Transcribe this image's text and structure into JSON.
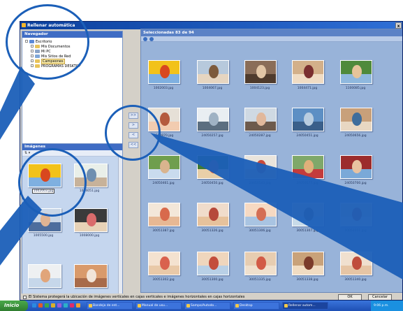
{
  "window": {
    "title": "Rellenar automática",
    "close_label": "x"
  },
  "navigator": {
    "header": "Navegador",
    "tree": [
      {
        "label": "Escritorio",
        "icon": "desktop-icon",
        "indent": 0,
        "color": "#5b8ad8"
      },
      {
        "label": "Mis Documentos",
        "icon": "folder-icon",
        "indent": 1,
        "color": "#e8c35a"
      },
      {
        "label": "Mi PC",
        "icon": "computer-icon",
        "indent": 1,
        "color": "#8aa4c8"
      },
      {
        "label": "Mis Sitios de Red",
        "icon": "network-icon",
        "indent": 1,
        "color": "#7fa7d8"
      },
      {
        "label": "Campeones",
        "icon": "folder-icon",
        "indent": 1,
        "color": "#e8c35a",
        "selected": true
      },
      {
        "label": "PROGRAMAS DESKTOP",
        "icon": "folder-icon",
        "indent": 1,
        "color": "#e8c35a"
      }
    ]
  },
  "images_panel": {
    "header": "Imágenes",
    "toolbar": "⇅ ▾",
    "thumbs": [
      {
        "caption": "1002003.jpg",
        "selected": true,
        "c1": "#f2c21a",
        "c2": "#d8471f",
        "c3": "#7fb0e0"
      },
      {
        "caption": "1004051.jpg",
        "selected": false,
        "c1": "#e9efe9",
        "c2": "#6f8fb0",
        "c3": "#c7b29a"
      },
      {
        "caption": "1005500.jpg",
        "selected": false,
        "c1": "#c9d6e6",
        "c2": "#e0b493",
        "c3": "#4d6d9d"
      },
      {
        "caption": "1008000.jpg",
        "selected": false,
        "c1": "#3a3a3a",
        "c2": "#d96b6b",
        "c3": "#e7d2b7"
      },
      {
        "caption": "",
        "selected": false,
        "c1": "#eef0f2",
        "c2": "#e1a57a",
        "c3": "#c6d7ea"
      },
      {
        "caption": "",
        "selected": false,
        "c1": "#d99a6b",
        "c2": "#f1e4d8",
        "c3": "#a86b4a"
      }
    ]
  },
  "move_buttons": [
    ">>",
    ">",
    "<",
    "<<"
  ],
  "selected_panel": {
    "header": "Seleccionadas 83 de 94",
    "thumbs": [
      {
        "caption": "1002003.jpg",
        "c1": "#f2c21a",
        "c2": "#d8471f",
        "c3": "#7fb0e0"
      },
      {
        "caption": "1004067.jpg",
        "c1": "#b7c9dc",
        "c2": "#7d5a3c",
        "c3": "#e6d5c0"
      },
      {
        "caption": "1004123.jpg",
        "c1": "#8a6d58",
        "c2": "#e2c6a6",
        "c3": "#4f3b2d"
      },
      {
        "caption": "1004471.jpg",
        "c1": "#d3b08a",
        "c2": "#7a2f2f",
        "c3": "#f0dcc4"
      },
      {
        "caption": "1100085.jpg",
        "c1": "#4f8a3b",
        "c2": "#e6c49a",
        "c3": "#8fb8de"
      },
      {
        "caption": "1508870.jpg",
        "c1": "#e6e0d7",
        "c2": "#b45a3e",
        "c3": "#f2ccb0"
      },
      {
        "caption": "24050257.jpg",
        "c1": "#e9eef2",
        "c2": "#9fb2c4",
        "c3": "#5b6e80"
      },
      {
        "caption": "24050287.jpg",
        "c1": "#cfd9e3",
        "c2": "#e1b89c",
        "c3": "#6d5a4d"
      },
      {
        "caption": "24050451.jpg",
        "c1": "#5d8fc4",
        "c2": "#b9cde0",
        "c3": "#3a5f8a"
      },
      {
        "caption": "24050656.jpg",
        "c1": "#c8a07a",
        "c2": "#3e6d9c",
        "c3": "#e8d7c2"
      },
      {
        "caption": "24050461.jpg",
        "c1": "#6f9e4e",
        "c2": "#d9b48e",
        "c3": "#c9dbee"
      },
      {
        "caption": "24050450.jpg",
        "c1": "#3f7a35",
        "c2": "#d75a3a",
        "c3": "#e8cfa8"
      },
      {
        "caption": "24050543.jpg",
        "c1": "#e9e4dc",
        "c2": "#c84a3b",
        "c3": "#e3c3a1"
      },
      {
        "caption": "24050577.jpg",
        "c1": "#7fa86a",
        "c2": "#e0b07a",
        "c3": "#c43c3c"
      },
      {
        "caption": "24050700.jpg",
        "c1": "#9c2c2c",
        "c2": "#e8c2a0",
        "c3": "#7aa9d8"
      },
      {
        "caption": "30051387.jpg",
        "c1": "#f3e7d9",
        "c2": "#d86a4c",
        "c3": "#e7b894"
      },
      {
        "caption": "30051326.jpg",
        "c1": "#f0dccb",
        "c2": "#b6493b",
        "c3": "#e6c29c"
      },
      {
        "caption": "30051306.jpg",
        "c1": "#f6d9c2",
        "c2": "#d46e54",
        "c3": "#a9c4e2"
      },
      {
        "caption": "30051307.jpg",
        "c1": "#e4d2bd",
        "c2": "#7b5644",
        "c3": "#c8dbe9"
      },
      {
        "caption": "30051311.jpg",
        "c1": "#e5cfb6",
        "c2": "#c2452f",
        "c3": "#f2e4d2"
      },
      {
        "caption": "30051302.jpg",
        "c1": "#f4e2d0",
        "c2": "#d9614d",
        "c3": "#e9c9a8"
      },
      {
        "caption": "30051300.jpg",
        "c1": "#efd6bd",
        "c2": "#c34e3c",
        "c3": "#b9d0e6"
      },
      {
        "caption": "30051335.jpg",
        "c1": "#e7cdb1",
        "c2": "#d25b46",
        "c3": "#f0e0cd"
      },
      {
        "caption": "30051338.jpg",
        "c1": "#c9a27a",
        "c2": "#7b3b2b",
        "c3": "#f1dcc2"
      },
      {
        "caption": "30051340.jpg",
        "c1": "#f0e0cf",
        "c2": "#bf4d3b",
        "c3": "#e6c5a5"
      }
    ]
  },
  "bottom": {
    "checkbox_label": "El Sistema protegerá la ubicación de imágenes verticales en cajas verticales e imágenes horizontales en cajas horizontales",
    "ok_label": "OK",
    "cancel_label": "Cancelar"
  },
  "taskbar": {
    "start_label": "Inicio",
    "quick_launch_colors": [
      "#2b8ae0",
      "#e05a2b",
      "#3aa84a",
      "#d8b02b",
      "#9c5ad8",
      "#2bb0c8",
      "#e02b6a",
      "#f0a030"
    ],
    "tasks": [
      {
        "label": "Bandeja de ent...",
        "active": false
      },
      {
        "label": "Manual de usu...",
        "active": false
      },
      {
        "label": "Sampo/Autodo...",
        "active": false
      },
      {
        "label": "Desktop",
        "active": false
      },
      {
        "label": "Rellenar autom...",
        "active": true
      }
    ],
    "tray_text": "9:06 p.m."
  },
  "colors": {
    "overlay": "#1b5fb8",
    "selected_bg": "#98b3d9",
    "images_bg": "#c5d6ee"
  }
}
